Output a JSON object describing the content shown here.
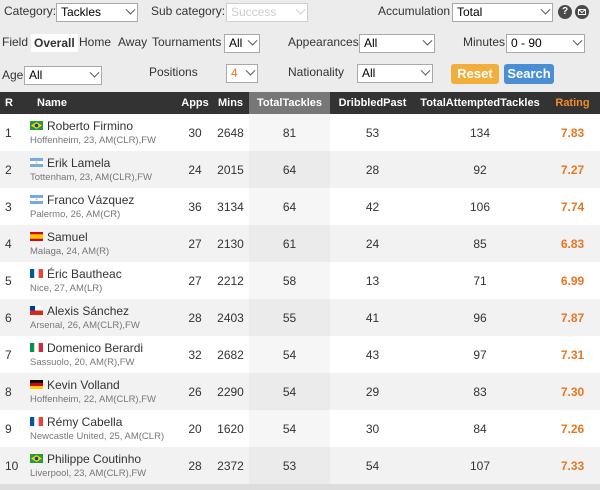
{
  "filters": {
    "category_label": "Category:",
    "category_value": "Tackles",
    "subcategory_label": "Sub category:",
    "subcategory_value": "Success",
    "accumulation_label": "Accumulation",
    "accumulation_value": "Total",
    "help_icon_text": "?",
    "field_label": "Field",
    "field_options": [
      "Overall",
      "Home",
      "Away"
    ],
    "tournaments_label": "Tournaments",
    "tournaments_value": "All",
    "appearances_label": "Appearances",
    "appearances_value": "All",
    "minutes_label": "Minutes",
    "minutes_value": "0 - 90",
    "age_label": "Age",
    "age_value": "All",
    "positions_label": "Positions",
    "positions_value": "4",
    "nationality_label": "Nationality",
    "nationality_value": "All",
    "reset_label": "Reset",
    "search_label": "Search"
  },
  "table": {
    "headers": [
      "R",
      "Name",
      "Apps",
      "Mins",
      "TotalTackles",
      "DribbledPast",
      "TotalAttemptedTackles",
      "Rating"
    ],
    "rows": [
      {
        "rank": "1",
        "flag": "brazil",
        "name": "Roberto Firmino",
        "info": "Hoffenheim, 23, AM(CLR),FW",
        "apps": "30",
        "mins": "2648",
        "total_tackles": "81",
        "dribbled_past": "53",
        "attempted": "134",
        "rating": "7.83"
      },
      {
        "rank": "2",
        "flag": "argentina",
        "name": "Erik Lamela",
        "info": "Tottenham, 23, AM(CLR),FW",
        "apps": "24",
        "mins": "2015",
        "total_tackles": "64",
        "dribbled_past": "28",
        "attempted": "92",
        "rating": "7.27"
      },
      {
        "rank": "3",
        "flag": "argentina",
        "name": "Franco Vázquez",
        "info": "Palermo, 26, AM(CR)",
        "apps": "36",
        "mins": "3134",
        "total_tackles": "64",
        "dribbled_past": "42",
        "attempted": "106",
        "rating": "7.74"
      },
      {
        "rank": "4",
        "flag": "spain",
        "name": "Samuel",
        "info": "Malaga, 24, AM(R)",
        "apps": "27",
        "mins": "2130",
        "total_tackles": "61",
        "dribbled_past": "24",
        "attempted": "85",
        "rating": "6.83"
      },
      {
        "rank": "5",
        "flag": "france",
        "name": "Éric Bautheac",
        "info": "Nice, 27, AM(LR)",
        "apps": "27",
        "mins": "2212",
        "total_tackles": "58",
        "dribbled_past": "13",
        "attempted": "71",
        "rating": "6.99"
      },
      {
        "rank": "6",
        "flag": "chile",
        "name": "Alexis Sánchez",
        "info": "Arsenal, 26, AM(CLR),FW",
        "apps": "28",
        "mins": "2403",
        "total_tackles": "55",
        "dribbled_past": "41",
        "attempted": "96",
        "rating": "7.87"
      },
      {
        "rank": "7",
        "flag": "italy",
        "name": "Domenico Berardi",
        "info": "Sassuolo, 20, AM(R),FW",
        "apps": "32",
        "mins": "2682",
        "total_tackles": "54",
        "dribbled_past": "43",
        "attempted": "97",
        "rating": "7.31"
      },
      {
        "rank": "8",
        "flag": "germany",
        "name": "Kevin Volland",
        "info": "Hoffenheim, 22, AM(CLR),FW",
        "apps": "26",
        "mins": "2290",
        "total_tackles": "54",
        "dribbled_past": "29",
        "attempted": "83",
        "rating": "7.30"
      },
      {
        "rank": "9",
        "flag": "france",
        "name": "Rémy Cabella",
        "info": "Newcastle United, 25, AM(CLR)",
        "apps": "20",
        "mins": "1620",
        "total_tackles": "54",
        "dribbled_past": "30",
        "attempted": "84",
        "rating": "7.26"
      },
      {
        "rank": "10",
        "flag": "brazil",
        "name": "Philippe Coutinho",
        "info": "Liverpool, 23, AM(CLR),FW",
        "apps": "28",
        "mins": "2372",
        "total_tackles": "53",
        "dribbled_past": "54",
        "attempted": "107",
        "rating": "7.33"
      }
    ]
  },
  "colors": {
    "header_bg": "#333333",
    "sorted_header_bg": "#777777",
    "rating_color": "#e87722",
    "reset_button": "#f2ae3b",
    "search_button": "#4a8fd6"
  }
}
